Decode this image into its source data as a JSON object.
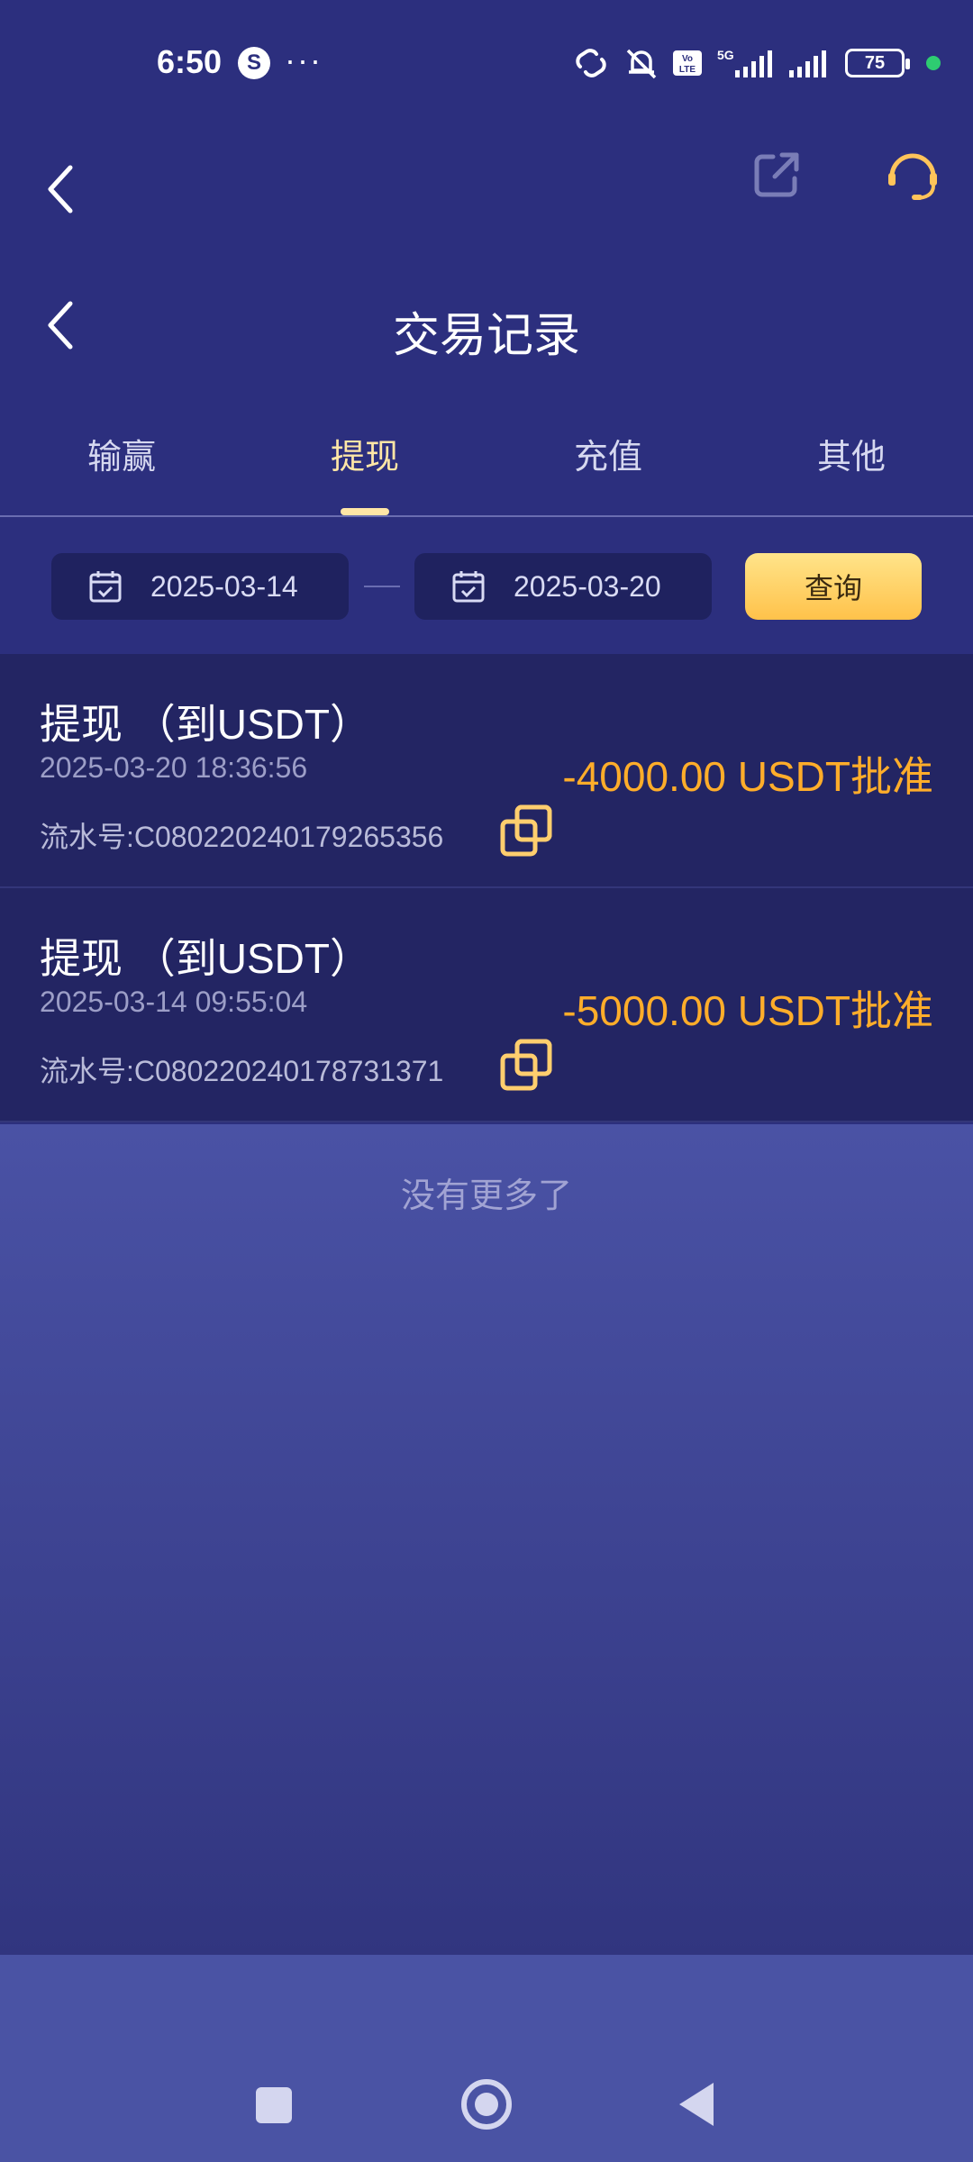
{
  "status_bar": {
    "time": "6:50",
    "battery": "75",
    "network_5g": "5G",
    "volte": "Vo LTE"
  },
  "header": {
    "title": "交易记录"
  },
  "tabs": [
    {
      "label": "输赢",
      "active": false
    },
    {
      "label": "提现",
      "active": true
    },
    {
      "label": "充值",
      "active": false
    },
    {
      "label": "其他",
      "active": false
    }
  ],
  "filter": {
    "start_date": "2025-03-14",
    "end_date": "2025-03-20",
    "query_label": "查询"
  },
  "records": [
    {
      "title": "提现 （到USDT）",
      "time": "2025-03-20 18:36:56",
      "serial": "流水号:C080220240179265356",
      "amount": "-4000.00 USDT批准"
    },
    {
      "title": "提现 （到USDT）",
      "time": "2025-03-14 09:55:04",
      "serial": "流水号:C080220240178731371",
      "amount": "-5000.00 USDT批准"
    }
  ],
  "list_footer": "没有更多了",
  "colors": {
    "background": "#2c2f7e",
    "accent_amount": "#ffad2a",
    "tab_active": "#ffe6a6",
    "query_button": "#ffc24a"
  }
}
